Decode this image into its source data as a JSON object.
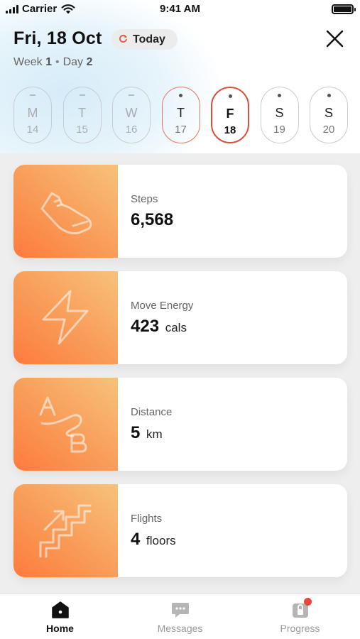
{
  "status_bar": {
    "carrier": "Carrier",
    "time": "9:41 AM"
  },
  "header": {
    "date": "Fri, 18 Oct",
    "today_button": "Today",
    "week_label": "Week",
    "week_number": "1",
    "day_label": "Day",
    "day_number": "2"
  },
  "days": [
    {
      "letter": "M",
      "num": "14",
      "state": "past"
    },
    {
      "letter": "T",
      "num": "15",
      "state": "past"
    },
    {
      "letter": "W",
      "num": "16",
      "state": "past"
    },
    {
      "letter": "T",
      "num": "17",
      "state": "yesterday"
    },
    {
      "letter": "F",
      "num": "18",
      "state": "selected"
    },
    {
      "letter": "S",
      "num": "19",
      "state": "future"
    },
    {
      "letter": "S",
      "num": "20",
      "state": "future"
    }
  ],
  "cards": [
    {
      "label": "Steps",
      "value": "6,568",
      "unit": "",
      "icon": "sneaker-icon"
    },
    {
      "label": "Move Energy",
      "value": "423",
      "unit": "cals",
      "icon": "lightning-icon"
    },
    {
      "label": "Distance",
      "value": "5",
      "unit": "km",
      "icon": "a-to-b-icon"
    },
    {
      "label": "Flights",
      "value": "4",
      "unit": "floors",
      "icon": "stairs-icon"
    }
  ],
  "tabs": [
    {
      "label": "Home",
      "icon": "home-icon",
      "active": true
    },
    {
      "label": "Messages",
      "icon": "chat-icon",
      "active": false
    },
    {
      "label": "Progress",
      "icon": "progress-icon",
      "active": false,
      "badge": true
    }
  ],
  "colors": {
    "accent": "#d8503a",
    "tile_start": "#ff7a3d",
    "tile_end": "#f7c27c",
    "badge": "#e8473a"
  }
}
